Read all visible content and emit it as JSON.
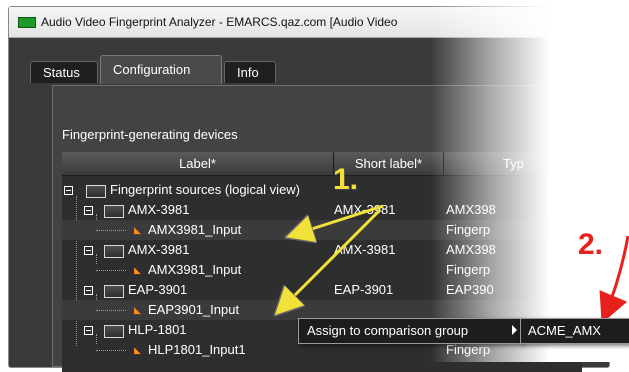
{
  "window": {
    "title": "Audio Video Fingerprint Analyzer - EMARCS.qaz.com [Audio Video"
  },
  "tabs": [
    {
      "label": "Status",
      "active": false
    },
    {
      "label": "Configuration",
      "active": true
    },
    {
      "label": "Info",
      "active": false
    }
  ],
  "section": {
    "label": "Fingerprint-generating devices"
  },
  "table": {
    "columns": [
      "Label*",
      "Short label*",
      "Typ"
    ],
    "rows": [
      {
        "label": "Fingerprint sources (logical view)",
        "short": "",
        "type": "",
        "level": 0,
        "kind": "folder"
      },
      {
        "label": "AMX-3981",
        "short": "AMX-3981",
        "type": "AMX398",
        "level": 1,
        "kind": "folder"
      },
      {
        "label": "AMX3981_Input",
        "short": "",
        "type": "Fingerp",
        "level": 2,
        "kind": "input"
      },
      {
        "label": "AMX-3981",
        "short": "AMX-3981",
        "type": "AMX398",
        "level": 1,
        "kind": "folder"
      },
      {
        "label": "AMX3981_Input",
        "short": "",
        "type": "Fingerp",
        "level": 2,
        "kind": "input"
      },
      {
        "label": "EAP-3901",
        "short": "EAP-3901",
        "type": "EAP390",
        "level": 1,
        "kind": "folder"
      },
      {
        "label": "EAP3901_Input",
        "short": "",
        "type": "",
        "level": 2,
        "kind": "input"
      },
      {
        "label": "HLP-1801",
        "short": "",
        "type": "",
        "level": 1,
        "kind": "folder"
      },
      {
        "label": "HLP1801_Input1",
        "short": "",
        "type": "Fingerp",
        "level": 2,
        "kind": "input"
      }
    ]
  },
  "context_menu": {
    "item": "Assign to comparison group",
    "submenu_item": "ACME_AMX"
  },
  "annotations": {
    "step1": "1.",
    "step2": "2."
  },
  "colors": {
    "annotation_yellow": "#f2e13a",
    "annotation_red": "#e8201b",
    "accent_green": "#1f9a2a"
  }
}
